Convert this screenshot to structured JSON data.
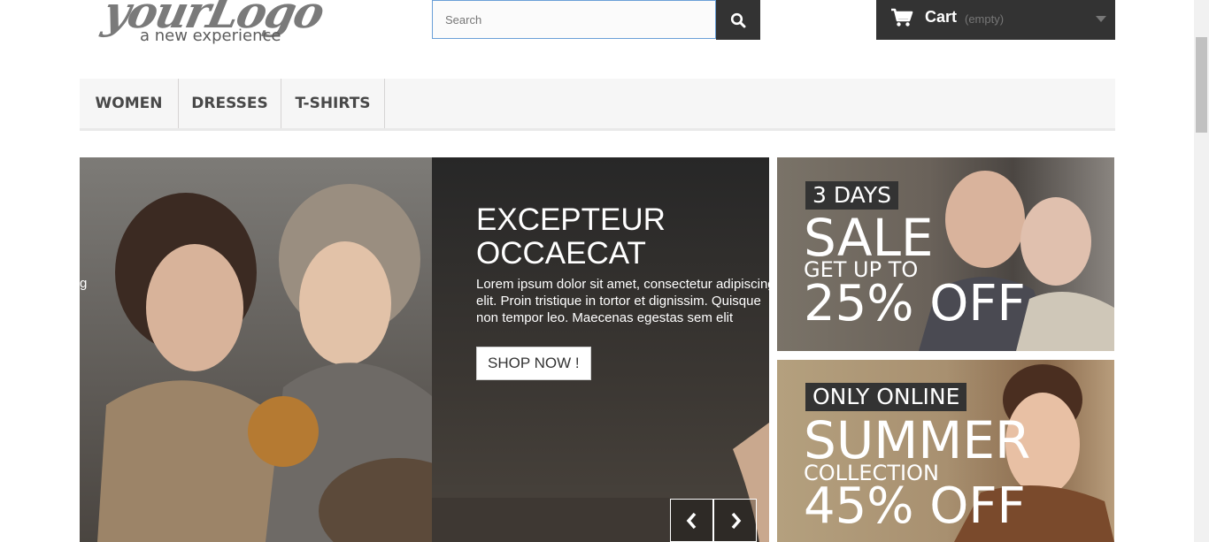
{
  "header": {
    "logo": {
      "script_text": "yourLogo",
      "tagline": "a new experience"
    },
    "search": {
      "placeholder": "Search",
      "value": ""
    },
    "cart": {
      "label": "Cart",
      "status": "(empty)"
    }
  },
  "nav": {
    "items": [
      "WOMEN",
      "DRESSES",
      "T-SHIRTS"
    ]
  },
  "slider": {
    "edge_text": "g",
    "title_line1": "EXCEPTEUR",
    "title_line2": "OCCAECAT",
    "text_line1": "Lorem ipsum dolor sit amet, consectetur adipiscing",
    "text_line2": "elit. Proin tristique in tortor et dignissim. Quisque",
    "text_line3": "non tempor leo. Maecenas egestas sem elit",
    "button": "SHOP NOW !"
  },
  "banners": [
    {
      "tag": "3 DAYS",
      "big": "SALE",
      "mid": "GET UP TO",
      "pct": "25% OFF"
    },
    {
      "tag": "ONLY ONLINE",
      "big": "SUMMER",
      "mid": "COLLECTION",
      "pct": "45% OFF"
    }
  ],
  "colors": {
    "dark": "#333333",
    "nav_bg": "#f6f6f6",
    "search_border": "#6aa0d8"
  },
  "icons": {
    "search": "magnifier-icon",
    "cart": "shopping-cart-icon",
    "prev": "chevron-left-icon",
    "next": "chevron-right-icon"
  }
}
